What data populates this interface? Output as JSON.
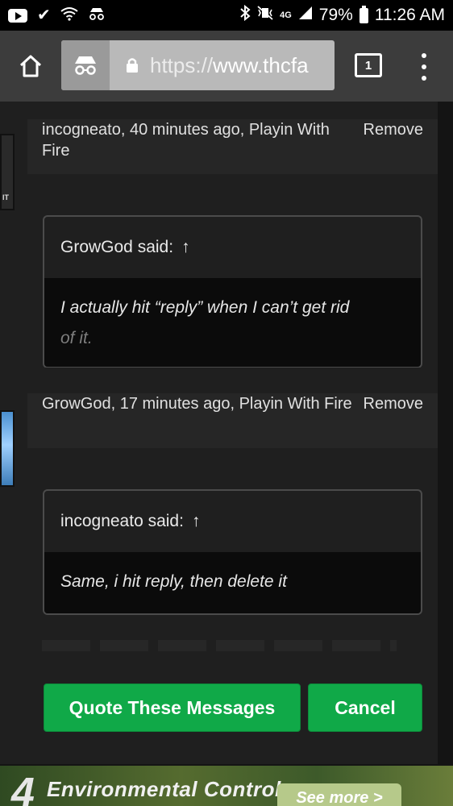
{
  "status_bar": {
    "battery": "79%",
    "time": "11:26 AM",
    "network": "4G"
  },
  "browser": {
    "url_scheme": "https://",
    "url_host": "www.thcfa",
    "tab_count": "1"
  },
  "messages": [
    {
      "meta": "incogneato, 40 minutes ago, Playin With Fire",
      "remove_label": "Remove",
      "quote": {
        "author_line": "GrowGod said:",
        "arrow": "↑",
        "text_line1": "I actually hit “reply” when I can’t get rid",
        "text_line2": "of it."
      }
    },
    {
      "meta": "GrowGod, 17 minutes ago, Playin With Fire",
      "remove_label": "Remove",
      "quote": {
        "author_line": "incogneato said:",
        "arrow": "↑",
        "text_line1": "Same, i hit reply, then delete it"
      }
    }
  ],
  "actions": {
    "quote_label": "Quote These Messages",
    "cancel_label": "Cancel"
  },
  "ad": {
    "number": "4",
    "title": "Environmental Controls",
    "button": "See more >"
  },
  "colors": {
    "accent_green": "#10a948",
    "toolbar": "#3c3c3c"
  }
}
